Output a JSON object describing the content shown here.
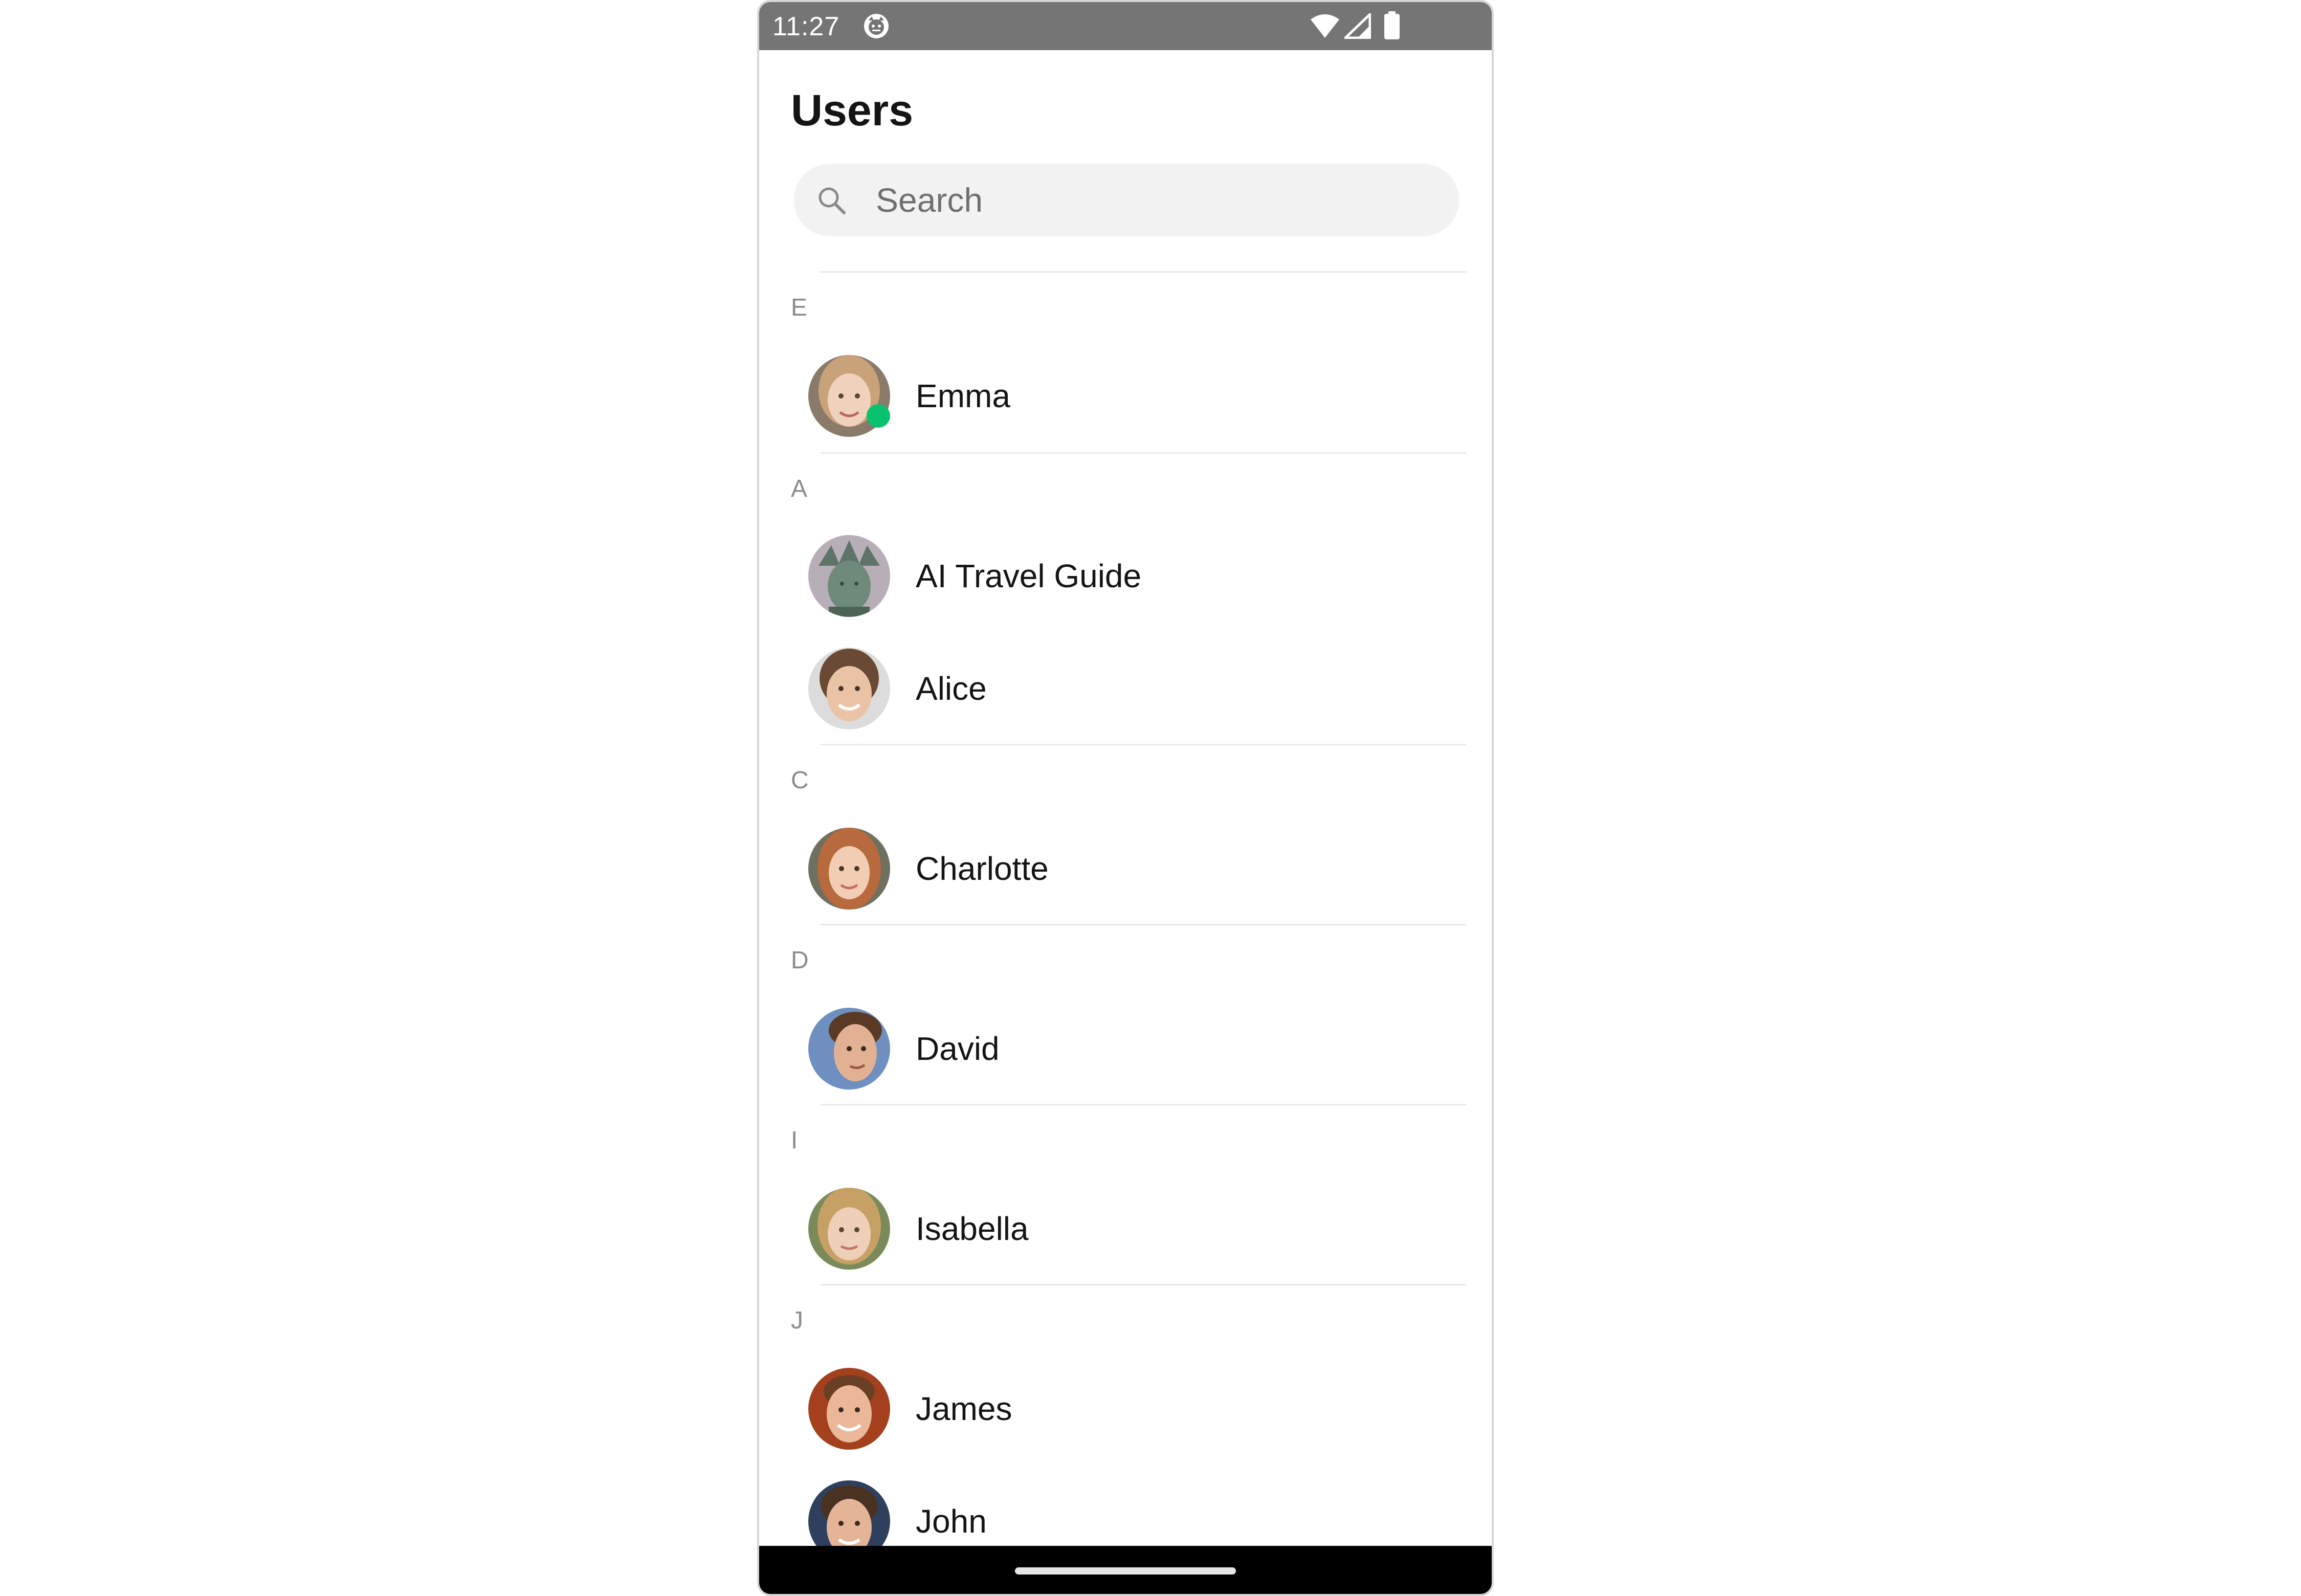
{
  "status_bar": {
    "time": "11:27",
    "app_icon": "app-notification-icon",
    "icons": [
      "wifi-icon",
      "cell-signal-icon",
      "battery-icon"
    ]
  },
  "screen": {
    "title": "Users",
    "search": {
      "placeholder": "Search",
      "icon": "search-icon"
    }
  },
  "sections": [
    {
      "letter": "E",
      "users": [
        {
          "name": "Emma",
          "online": true
        }
      ]
    },
    {
      "letter": "A",
      "users": [
        {
          "name": "AI Travel Guide",
          "online": false
        },
        {
          "name": "Alice",
          "online": false
        }
      ]
    },
    {
      "letter": "C",
      "users": [
        {
          "name": "Charlotte",
          "online": false
        }
      ]
    },
    {
      "letter": "D",
      "users": [
        {
          "name": "David",
          "online": false
        }
      ]
    },
    {
      "letter": "I",
      "users": [
        {
          "name": "Isabella",
          "online": false
        }
      ]
    },
    {
      "letter": "J",
      "users": [
        {
          "name": "James",
          "online": false
        },
        {
          "name": "John",
          "online": false
        }
      ]
    }
  ],
  "colors": {
    "status_bar": "#757575",
    "online_indicator": "#09c26f",
    "search_background": "#f2f2f2",
    "section_letter": "#8c8c8c"
  }
}
